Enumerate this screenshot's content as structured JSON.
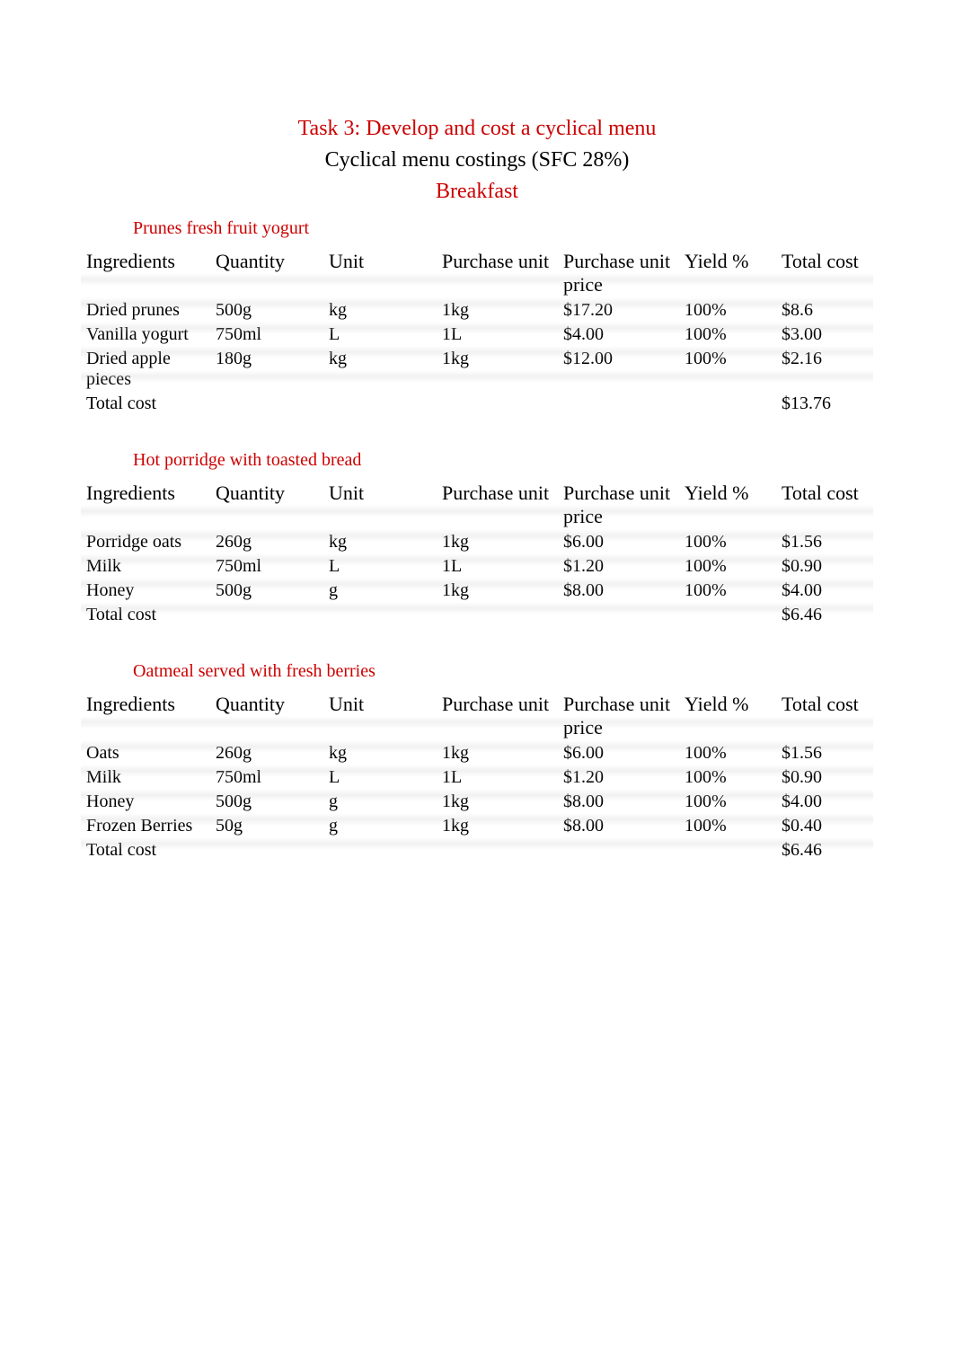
{
  "headings": {
    "task_title": "Task 3: Develop and cost a cyclical menu",
    "subtitle": "Cyclical menu costings (SFC 28%)",
    "section": "Breakfast"
  },
  "columns": {
    "ingredients": "Ingredients",
    "quantity": "Quantity",
    "unit": "Unit",
    "purchase_unit": "Purchase unit",
    "purchase_unit_price": "Purchase unit price",
    "yield_pct": "Yield %",
    "total_cost": "Total cost"
  },
  "total_cost_label": "Total cost",
  "recipes": [
    {
      "title": "Prunes fresh fruit yogurt",
      "rows": [
        {
          "ingredient": "Dried prunes",
          "quantity": "500g",
          "unit": "kg",
          "purchase_unit": "1kg",
          "purchase_unit_price": "$17.20",
          "yield_pct": "100%",
          "total_cost": "$8.6"
        },
        {
          "ingredient": "Vanilla yogurt",
          "quantity": "750ml",
          "unit": "L",
          "purchase_unit": "1L",
          "purchase_unit_price": "$4.00",
          "yield_pct": "100%",
          "total_cost": "$3.00"
        },
        {
          "ingredient": "Dried apple pieces",
          "quantity": "180g",
          "unit": "kg",
          "purchase_unit": "1kg",
          "purchase_unit_price": "$12.00",
          "yield_pct": "100%",
          "total_cost": "$2.16"
        }
      ],
      "total_cost": "$13.76"
    },
    {
      "title": "Hot porridge with toasted bread",
      "rows": [
        {
          "ingredient": "Porridge oats",
          "quantity": "260g",
          "unit": "kg",
          "purchase_unit": "1kg",
          "purchase_unit_price": "$6.00",
          "yield_pct": "100%",
          "total_cost": "$1.56"
        },
        {
          "ingredient": "Milk",
          "quantity": "750ml",
          "unit": "L",
          "purchase_unit": "1L",
          "purchase_unit_price": "$1.20",
          "yield_pct": "100%",
          "total_cost": "$0.90"
        },
        {
          "ingredient": "Honey",
          "quantity": "500g",
          "unit": "g",
          "purchase_unit": "1kg",
          "purchase_unit_price": "$8.00",
          "yield_pct": "100%",
          "total_cost": "$4.00"
        }
      ],
      "total_cost": "$6.46"
    },
    {
      "title": "Oatmeal served with fresh berries",
      "rows": [
        {
          "ingredient": "Oats",
          "quantity": "260g",
          "unit": "kg",
          "purchase_unit": "1kg",
          "purchase_unit_price": "$6.00",
          "yield_pct": "100%",
          "total_cost": "$1.56"
        },
        {
          "ingredient": "Milk",
          "quantity": "750ml",
          "unit": "L",
          "purchase_unit": "1L",
          "purchase_unit_price": "$1.20",
          "yield_pct": "100%",
          "total_cost": "$0.90"
        },
        {
          "ingredient": "Honey",
          "quantity": "500g",
          "unit": "g",
          "purchase_unit": "1kg",
          "purchase_unit_price": "$8.00",
          "yield_pct": "100%",
          "total_cost": "$4.00"
        },
        {
          "ingredient": "Frozen Berries",
          "quantity": "50g",
          "unit": "g",
          "purchase_unit": "1kg",
          "purchase_unit_price": "$8.00",
          "yield_pct": "100%",
          "total_cost": "$0.40"
        }
      ],
      "total_cost": "$6.46"
    }
  ]
}
